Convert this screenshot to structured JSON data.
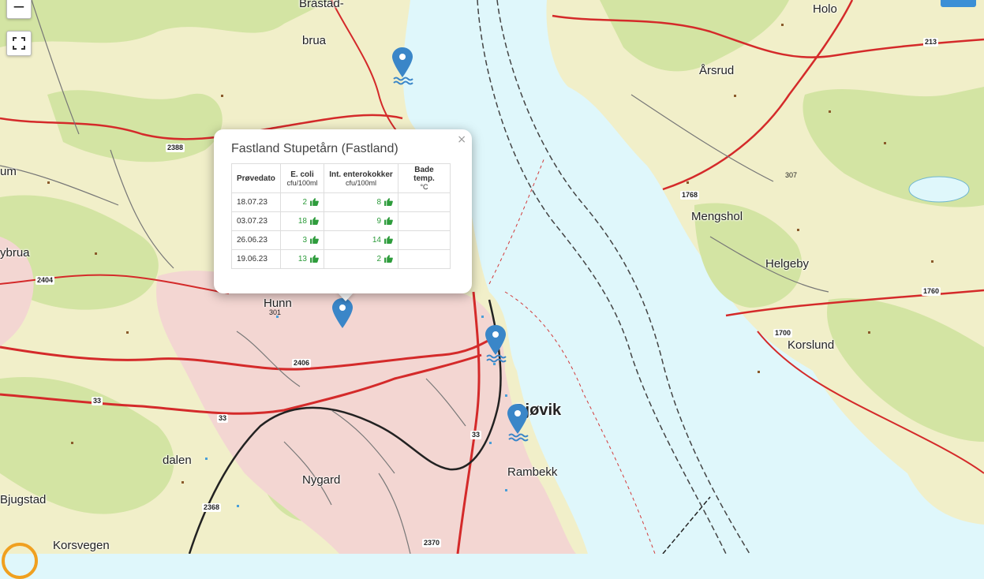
{
  "controls": {
    "zoom_out_label": "−",
    "fullscreen_icon": "fullscreen-icon"
  },
  "places": {
    "brastad": "Bråstad-",
    "brua": "brua",
    "holo": "Holo",
    "arsrud": "Årsrud",
    "um": "um",
    "mengshol": "Mengshol",
    "helgeby": "Helgeby",
    "ybrua": "ybrua",
    "hunn": "Hunn",
    "korslund": "Korslund",
    "gjovik": "Gjøvik",
    "dalen": "dalen",
    "rambekk": "Rambekk",
    "nygard": "Nygard",
    "bjugstad": "Bjugstad",
    "korsvegen": "Korsvegen"
  },
  "roads": [
    "213",
    "2388",
    "1768",
    "307",
    "2404",
    "1760",
    "1700",
    "301",
    "2406",
    "33",
    "33",
    "33",
    "2368",
    "2370"
  ],
  "popup": {
    "title": "Fastland Stupetårn (Fastland)",
    "close_label": "×",
    "columns": [
      {
        "label": "Prøvedato",
        "unit": ""
      },
      {
        "label": "E. coli",
        "unit": "cfu/100ml"
      },
      {
        "label": "Int. enterokokker",
        "unit": "cfu/100ml"
      },
      {
        "label": "Bade temp.",
        "unit": "°C"
      }
    ],
    "rows": [
      {
        "date": "18.07.23",
        "ecoli": "2",
        "entero": "8",
        "temp": ""
      },
      {
        "date": "03.07.23",
        "ecoli": "18",
        "entero": "9",
        "temp": ""
      },
      {
        "date": "26.06.23",
        "ecoli": "3",
        "entero": "14",
        "temp": ""
      },
      {
        "date": "19.06.23",
        "ecoli": "13",
        "entero": "2",
        "temp": ""
      }
    ],
    "good_icon": "thumbs-up-icon",
    "good_color": "#2e9c3c"
  },
  "colors": {
    "water": "#dff7fb",
    "land": "#f4f0c8",
    "forest": "#d7e6a6",
    "urban": "#f2d3d3",
    "main_road": "#d42a2a",
    "marker": "#3a86c8"
  }
}
